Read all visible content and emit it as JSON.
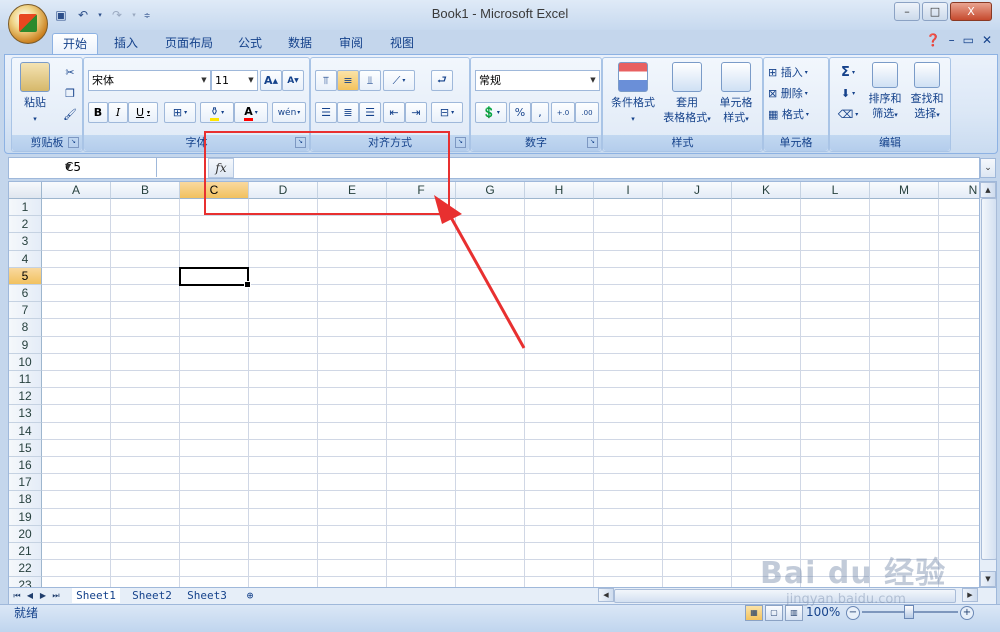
{
  "window": {
    "title": "Book1 - Microsoft Excel",
    "controls": [
      "–",
      "□",
      "X"
    ]
  },
  "tabs": [
    "开始",
    "插入",
    "页面布局",
    "公式",
    "数据",
    "审阅",
    "视图"
  ],
  "active_tab": "开始",
  "ribbon": {
    "clipboard": {
      "label": "剪贴板",
      "paste": "粘贴"
    },
    "font": {
      "label": "字体",
      "font_name": "宋体",
      "font_size": "11"
    },
    "alignment": {
      "label": "对齐方式"
    },
    "number": {
      "label": "数字",
      "format": "常规"
    },
    "styles": {
      "label": "样式",
      "cond_format": "条件格式",
      "table_format_1": "套用",
      "table_format_2": "表格格式",
      "cell_style_1": "单元格",
      "cell_style_2": "样式"
    },
    "cells": {
      "label": "单元格",
      "insert": "插入",
      "delete": "删除",
      "format": "格式"
    },
    "editing": {
      "label": "编辑",
      "sort_1": "排序和",
      "sort_2": "筛选",
      "find_1": "查找和",
      "find_2": "选择"
    }
  },
  "formula_bar": {
    "name_box": "C5",
    "fx": "fx",
    "content": ""
  },
  "columns": [
    "A",
    "B",
    "C",
    "D",
    "E",
    "F",
    "G",
    "H",
    "I",
    "J",
    "K",
    "L",
    "M",
    "N"
  ],
  "rows": [
    "1",
    "2",
    "3",
    "4",
    "5",
    "6",
    "7",
    "8",
    "9",
    "10",
    "11",
    "12",
    "13",
    "14",
    "15",
    "16",
    "17",
    "18",
    "19",
    "20",
    "21",
    "22",
    "23"
  ],
  "active_cell": {
    "column": "C",
    "row": "5"
  },
  "sheets": [
    "Sheet1",
    "Sheet2",
    "Sheet3"
  ],
  "active_sheet": "Sheet1",
  "status": {
    "ready": "就绪",
    "zoom": "100%",
    "zoom_level": 1.0
  },
  "watermark": {
    "line1": "Bai du 经验",
    "line2": "jingyan.baidu.com"
  },
  "colors": {
    "annotation": "#e83030",
    "ribbon": "#dbe7f6",
    "selection_header": "#f1c15f"
  }
}
